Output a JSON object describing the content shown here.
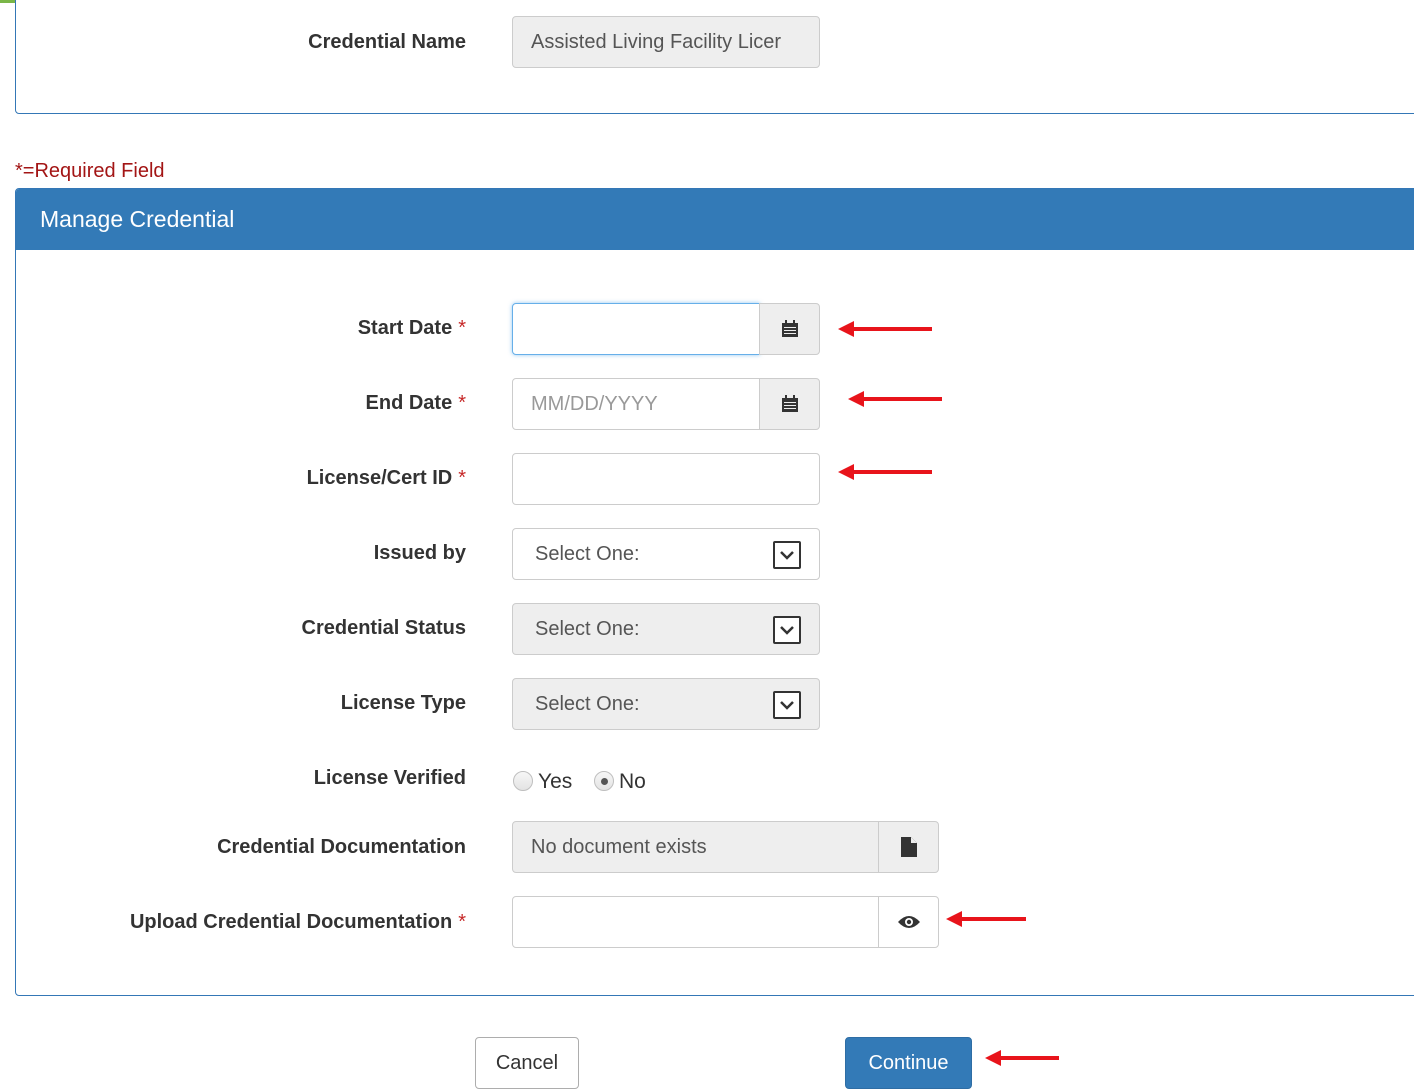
{
  "header": {
    "credential_name_label": "Credential Name",
    "credential_name_value": "Assisted Living Facility Licer"
  },
  "required_note": "*=Required Field",
  "panel": {
    "title": "Manage Credential"
  },
  "form": {
    "start_date": {
      "label": "Start Date",
      "required": "*",
      "value": ""
    },
    "end_date": {
      "label": "End Date",
      "required": "*",
      "placeholder": "MM/DD/YYYY"
    },
    "license_id": {
      "label": "License/Cert ID",
      "required": "*",
      "value": ""
    },
    "issued_by": {
      "label": "Issued by",
      "selected": "Select One:"
    },
    "credential_status": {
      "label": "Credential Status",
      "selected": "Select One:"
    },
    "license_type": {
      "label": "License Type",
      "selected": "Select One:"
    },
    "license_verified": {
      "label": "License Verified",
      "options": [
        "Yes",
        "No"
      ],
      "selected": "No"
    },
    "credential_documentation": {
      "label": "Credential Documentation",
      "value": "No document exists"
    },
    "upload_documentation": {
      "label": "Upload Credential Documentation",
      "required": "*",
      "value": ""
    }
  },
  "actions": {
    "cancel_label": "Cancel",
    "continue_label": "Continue"
  },
  "colors": {
    "accent_green": "#7ab648",
    "panel_blue": "#337ab7",
    "required_red": "#c62828",
    "annotation_arrow": "#e8141b"
  },
  "icons": [
    "calendar-icon",
    "chevron-down-icon",
    "file-icon",
    "eye-icon",
    "red-arrow-annotation"
  ]
}
